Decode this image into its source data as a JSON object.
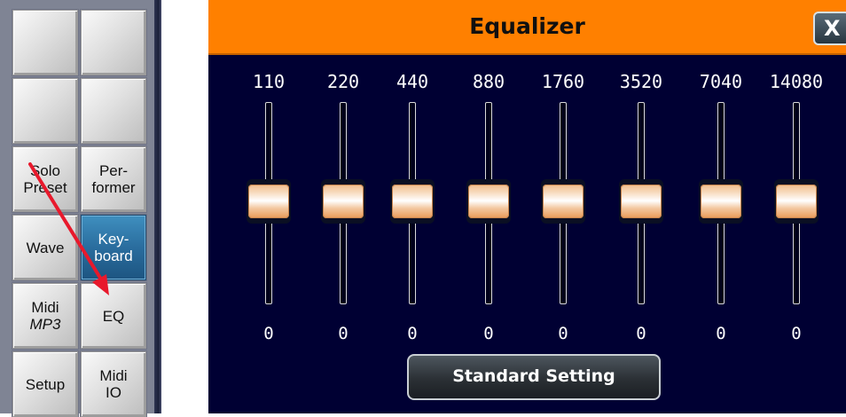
{
  "left_panel": {
    "buttons": [
      {
        "id": "empty-1",
        "lines": []
      },
      {
        "id": "empty-2",
        "lines": []
      },
      {
        "id": "empty-3",
        "lines": []
      },
      {
        "id": "empty-4",
        "lines": []
      },
      {
        "id": "solo-preset",
        "lines": [
          "Solo",
          "Preset"
        ]
      },
      {
        "id": "performer",
        "lines": [
          "Per-",
          "former"
        ]
      },
      {
        "id": "wave",
        "lines": [
          "Wave"
        ]
      },
      {
        "id": "keyboard",
        "lines": [
          "Key-",
          "board"
        ],
        "active": true
      },
      {
        "id": "midi-mp3",
        "lines": [
          "Midi",
          "MP3"
        ]
      },
      {
        "id": "eq",
        "lines": [
          "EQ"
        ]
      },
      {
        "id": "setup",
        "lines": [
          "Setup"
        ]
      },
      {
        "id": "midi-io",
        "lines": [
          "Midi",
          "IO"
        ]
      }
    ],
    "annotation_arrow_color": "#e8192c"
  },
  "dialog": {
    "title": "Equalizer",
    "close_label": "X",
    "title_bg": "#ff8000",
    "body_bg": "#000033",
    "bands": [
      {
        "freq": "110",
        "value": "0"
      },
      {
        "freq": "220",
        "value": "0"
      },
      {
        "freq": "440",
        "value": "0"
      },
      {
        "freq": "880",
        "value": "0"
      },
      {
        "freq": "1760",
        "value": "0"
      },
      {
        "freq": "3520",
        "value": "0"
      },
      {
        "freq": "7040",
        "value": "0"
      },
      {
        "freq": "14080",
        "value": "0"
      }
    ],
    "standard_setting_label": "Standard Setting"
  }
}
